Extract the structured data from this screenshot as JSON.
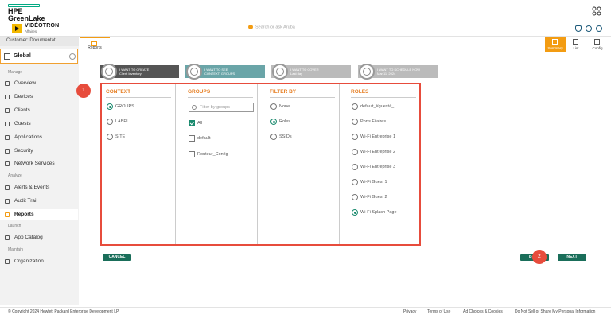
{
  "brand": {
    "line1": "HPE",
    "line2": "GreenLake"
  },
  "app": {
    "name": "VIDÉOTRON",
    "sub": "Affaires",
    "search_placeholder": "Search or ask Aruba"
  },
  "sidebar": {
    "customer": "Customer: Documentat...",
    "global": "Global",
    "sections": {
      "manage": "Manage",
      "analyze": "Analyze",
      "launch": "Launch",
      "maintain": "Maintain"
    },
    "items": [
      {
        "label": "Overview",
        "icon": "overview-icon"
      },
      {
        "label": "Devices",
        "icon": "devices-icon"
      },
      {
        "label": "Clients",
        "icon": "clients-icon"
      },
      {
        "label": "Guests",
        "icon": "guests-icon"
      },
      {
        "label": "Applications",
        "icon": "applications-icon"
      },
      {
        "label": "Security",
        "icon": "security-icon"
      },
      {
        "label": "Network Services",
        "icon": "network-services-icon"
      },
      {
        "label": "Alerts & Events",
        "icon": "alerts-icon"
      },
      {
        "label": "Audit Trail",
        "icon": "audit-icon"
      },
      {
        "label": "Reports",
        "icon": "reports-icon"
      },
      {
        "label": "App Catalog",
        "icon": "app-catalog-icon"
      },
      {
        "label": "Organization",
        "icon": "organization-icon"
      }
    ]
  },
  "tabs": {
    "reports": "Reports",
    "summary": "Summary",
    "list": "List",
    "config": "Config"
  },
  "steps": [
    {
      "line1": "I WANT TO CREATE",
      "line2": "Client Inventory",
      "color": "#555555"
    },
    {
      "line1": "I WANT TO SEE",
      "line2": "CONTEXT: GROUPS",
      "color": "#6aa5a8"
    },
    {
      "line1": "I WANT TO COVER",
      "line2": "Last day",
      "color": "#bbbbbb"
    },
    {
      "line1": "I WANT TO SCHEDULE NOW",
      "line2": "Mar 11, 2024",
      "color": "#bbbbbb"
    }
  ],
  "panel": {
    "context": {
      "title": "CONTEXT",
      "options": [
        "GROUPS",
        "LABEL",
        "SITE"
      ]
    },
    "groups": {
      "title": "GROUPS",
      "filter_placeholder": "Filter by groups",
      "options": [
        "All",
        "default",
        "Routeur_Config"
      ]
    },
    "filter_by": {
      "title": "FILTER BY",
      "options": [
        "None",
        "Roles",
        "SSIDs"
      ]
    },
    "roles": {
      "title": "ROLES",
      "options": [
        "default_#guest#_",
        "Ports Filaires",
        "Wi-Fi Entreprise 1",
        "Wi-Fi Entreprise 2",
        "Wi-Fi Entreprise 3",
        "Wi-Fi Guest 1",
        "Wi-Fi Guest 2",
        "Wi-Fi Splash Page"
      ]
    }
  },
  "badges": {
    "one": "1",
    "two": "2"
  },
  "buttons": {
    "cancel": "CANCEL",
    "back": "B",
    "next": "NEXT"
  },
  "footer": {
    "copyright": "© Copyright 2024 Hewlett Packard Enterprise Development LP",
    "privacy": "Privacy",
    "terms": "Terms of Use",
    "adchoices": "Ad Choices & Cookies",
    "donotsell": "Do Not Sell or Share My Personal Information"
  },
  "colors": {
    "accent": "#f39c12",
    "brand_green": "#01a982",
    "button": "#1a6e5a",
    "highlight": "#e74c3c"
  }
}
